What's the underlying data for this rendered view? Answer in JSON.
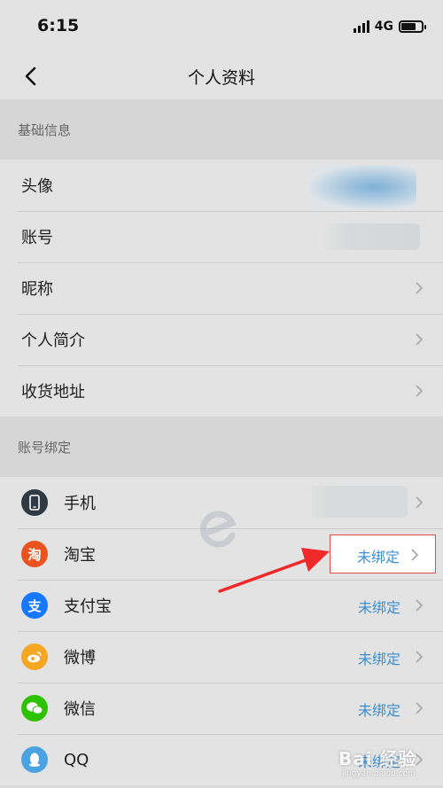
{
  "status_bar": {
    "time": "6:15",
    "network": "4G"
  },
  "nav": {
    "title": "个人资料"
  },
  "basic_section": {
    "header": "基础信息",
    "items": [
      {
        "label": "头像"
      },
      {
        "label": "账号"
      },
      {
        "label": "昵称"
      },
      {
        "label": "个人简介"
      },
      {
        "label": "收货地址"
      }
    ]
  },
  "binding_section": {
    "header": "账号绑定",
    "items": [
      {
        "label": "手机",
        "icon": "phone-icon",
        "color": "#2f3a45",
        "value": ""
      },
      {
        "label": "淘宝",
        "icon": "taobao-icon",
        "color": "#e8531f",
        "value": "未绑定",
        "icon_text": "淘"
      },
      {
        "label": "支付宝",
        "icon": "alipay-icon",
        "color": "#1677ff",
        "value": "未绑定",
        "icon_text": "支"
      },
      {
        "label": "微博",
        "icon": "weibo-icon",
        "color": "#f5a623",
        "value": "未绑定"
      },
      {
        "label": "微信",
        "icon": "wechat-icon",
        "color": "#2dc100",
        "value": "未绑定"
      },
      {
        "label": "QQ",
        "icon": "qq-icon",
        "color": "#4aa3e0",
        "value": "未绑定"
      }
    ]
  },
  "watermark": {
    "brand": "Bai 经验",
    "url": "jingyan.baidu.com"
  },
  "colors": {
    "value_text": "#3b8fd0",
    "highlight_border": "#e24a4a",
    "arrow": "#f02a2a"
  }
}
